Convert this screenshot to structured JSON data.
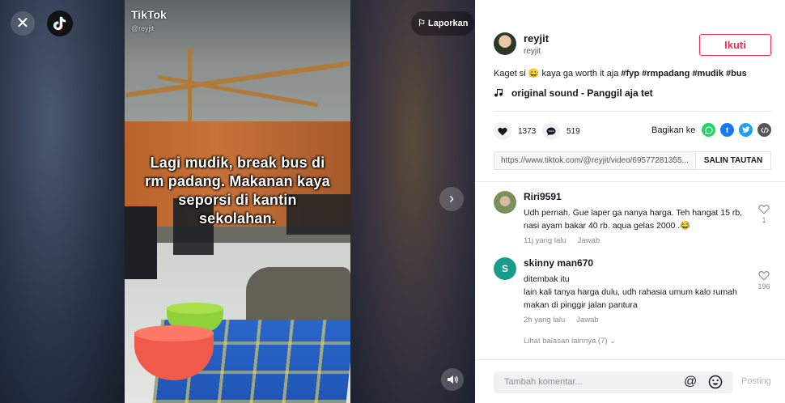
{
  "video": {
    "watermark": "TikTok",
    "watermark_user": "@reyjit",
    "caption": "Lagi mudik, break bus di rm padang. Makanan kaya seporsi di kantin sekolahan.",
    "report_label": "Laporkan"
  },
  "author": {
    "username": "reyjit",
    "nickname": "reyjit",
    "follow_label": "Ikuti"
  },
  "description": {
    "text": "Kaget si 😀 kaya ga worth it aja",
    "hashtags": [
      "#fyp",
      "#rmpadang",
      "#mudik",
      "#bus"
    ]
  },
  "sound": {
    "label": "original sound - Panggil aja tet"
  },
  "stats": {
    "likes": "1373",
    "comments": "519"
  },
  "share": {
    "label": "Bagikan ke",
    "icons": [
      "whatsapp-icon",
      "facebook-icon",
      "twitter-icon",
      "embed-icon"
    ],
    "colors": {
      "whatsapp": "#25d366",
      "facebook": "#1877f2",
      "twitter": "#1da1f2",
      "embed": "#555555"
    }
  },
  "link": {
    "url": "https://www.tiktok.com/@reyjit/video/69577281355...",
    "copy_label": "SALIN TAUTAN"
  },
  "comments": [
    {
      "user": "Riri9591",
      "text": "Udh pernah. Gue laper ga nanya harga. Teh hangat 15 rb, nasi ayam bakar 40 rb. aqua gelas 2000 .😂",
      "time": "11j yang lalu",
      "reply_label": "Jawab",
      "likes": "1",
      "avatar_letter": ""
    },
    {
      "user": "skinny man670",
      "text": "ditembak itu\nlain kali tanya harga dulu, udh rahasia umum kalo rumah makan di pinggir jalan pantura",
      "time": "2h yang lalu",
      "reply_label": "Jawab",
      "likes": "196",
      "avatar_letter": "S"
    }
  ],
  "more_replies": "Lihat balasan lainnya (7)",
  "comment_bar": {
    "placeholder": "Tambah komentar...",
    "post_label": "Posting"
  },
  "colors": {
    "brand": "#fe2c55",
    "text": "#161823",
    "muted": "#8a8b91"
  }
}
